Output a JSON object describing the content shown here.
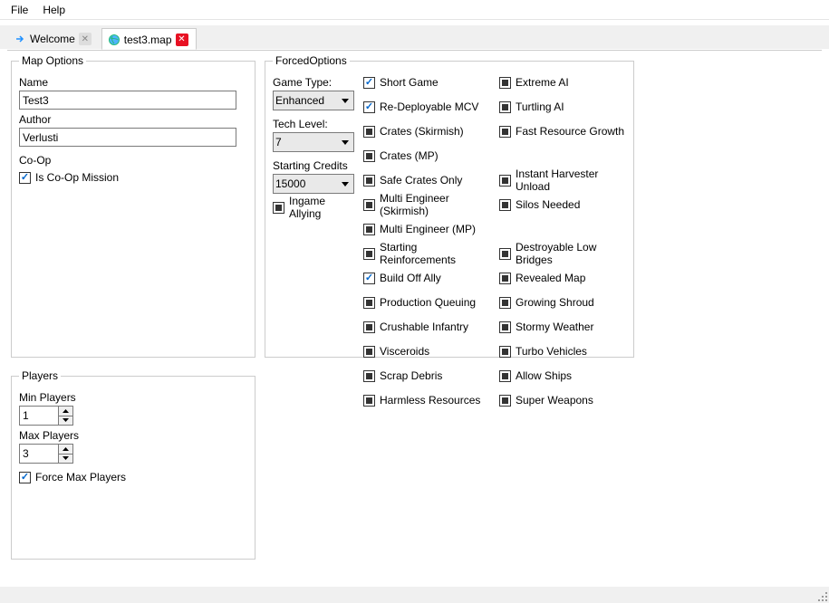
{
  "menu": {
    "file": "File",
    "help": "Help"
  },
  "tabs": {
    "welcome": "Welcome",
    "active": "test3.map"
  },
  "mapOptions": {
    "legend": "Map Options",
    "nameLabel": "Name",
    "nameValue": "Test3",
    "authorLabel": "Author",
    "authorValue": "Verlusti",
    "coopLabel": "Co-Op",
    "isCoop": "Is Co-Op Mission"
  },
  "forced": {
    "legend": "ForcedOptions",
    "gameTypeLabel": "Game Type:",
    "gameTypeValue": "Enhanced",
    "techLevelLabel": "Tech Level:",
    "techLevelValue": "7",
    "creditsLabel": "Starting Credits",
    "creditsValue": "15000",
    "ingameAllying": "Ingame Allying",
    "col1": [
      "Short Game",
      "Re-Deployable MCV",
      "Crates (Skirmish)",
      "Crates (MP)",
      "Safe Crates Only",
      "Multi Engineer (Skirmish)",
      "Multi Engineer (MP)",
      "Starting Reinforcements",
      "Build Off Ally",
      "Production Queuing",
      "Crushable Infantry",
      "Visceroids",
      "Scrap Debris",
      "Harmless Resources"
    ],
    "col2": [
      "Extreme AI",
      "Turtling AI",
      "Fast Resource Growth",
      "",
      "Instant Harvester Unload",
      "Silos Needed",
      "",
      "Destroyable Low Bridges",
      "Revealed Map",
      "Growing Shroud",
      "Stormy Weather",
      "Turbo Vehicles",
      "Allow Ships",
      "Super Weapons"
    ]
  },
  "players": {
    "legend": "Players",
    "minLabel": "Min Players",
    "minValue": "1",
    "maxLabel": "Max Players",
    "maxValue": "3",
    "forceMax": "Force Max Players"
  }
}
